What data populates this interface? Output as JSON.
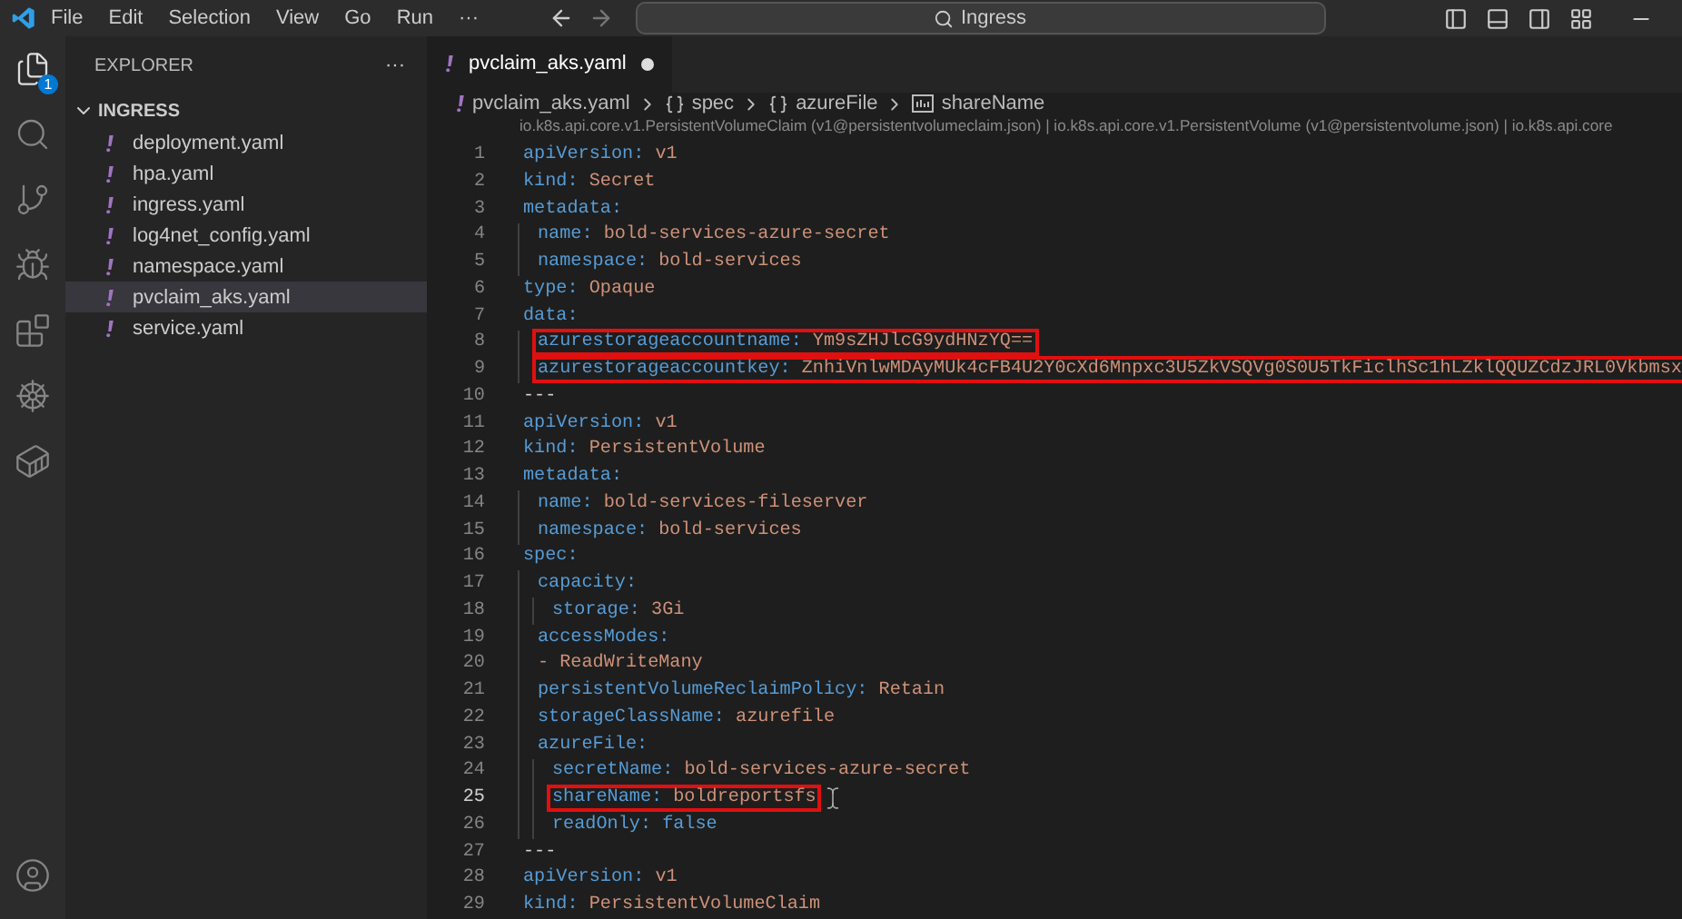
{
  "menu_bar": {
    "items": [
      "File",
      "Edit",
      "Selection",
      "View",
      "Go",
      "Run",
      "···"
    ],
    "search": {
      "value": "Ingress"
    }
  },
  "activity_bar": {
    "badge": "1"
  },
  "sidebar": {
    "title": "EXPLORER",
    "more": "···",
    "folder": {
      "label": "INGRESS",
      "expanded": true,
      "files": [
        {
          "label": "deployment.yaml",
          "selected": false
        },
        {
          "label": "hpa.yaml",
          "selected": false
        },
        {
          "label": "ingress.yaml",
          "selected": false
        },
        {
          "label": "log4net_config.yaml",
          "selected": false
        },
        {
          "label": "namespace.yaml",
          "selected": false
        },
        {
          "label": "pvclaim_aks.yaml",
          "selected": true
        },
        {
          "label": "service.yaml",
          "selected": false
        }
      ]
    }
  },
  "tabs": [
    {
      "label": "pvclaim_aks.yaml",
      "selected": true,
      "modified": true
    }
  ],
  "breadcrumb": [
    {
      "kind": "file",
      "label": "pvclaim_aks.yaml"
    },
    {
      "kind": "object",
      "label": "spec"
    },
    {
      "kind": "object",
      "label": "azureFile"
    },
    {
      "kind": "string",
      "label": "shareName"
    }
  ],
  "schema_info": "io.k8s.api.core.v1.PersistentVolumeClaim (v1@persistentvolumeclaim.json) | io.k8s.api.core.v1.PersistentVolume (v1@persistentvolume.json) | io.k8s.api.core",
  "editor": {
    "lines": [
      {
        "number": "1",
        "kind": "pair",
        "key": "apiVersion:",
        "value": "v1",
        "highlighted": false,
        "current": false
      },
      {
        "number": "2",
        "kind": "pair",
        "key": "kind:",
        "value": "Secret",
        "highlighted": false,
        "current": false
      },
      {
        "number": "3",
        "kind": "mapping",
        "key": "metadata:",
        "highlighted": false,
        "current": false,
        "children": [
          {
            "number": "4",
            "kind": "pair",
            "key": "name:",
            "value": "bold-services-azure-secret",
            "highlighted": false,
            "current": false
          },
          {
            "number": "5",
            "kind": "pair",
            "key": "namespace:",
            "value": "bold-services",
            "highlighted": false,
            "current": false
          }
        ]
      },
      {
        "number": "6",
        "kind": "pair",
        "key": "type:",
        "value": "Opaque",
        "highlighted": false,
        "current": false
      },
      {
        "number": "7",
        "kind": "mapping",
        "key": "data:",
        "highlighted": false,
        "current": false,
        "children": [
          {
            "number": "8",
            "kind": "pair",
            "key": "azurestorageaccountname:",
            "value": "Ym9sZHJlcG9ydHNzYQ==",
            "highlighted": true,
            "current": false
          },
          {
            "number": "9",
            "kind": "pair",
            "key": "azurestorageaccountkey:",
            "value": "ZnhiVnlwMDAyMUk4cFB4U2Y0cXd6Mnpxc3U5ZkVSQVg0S0U5TkFiclhSc1hLZklQQUZCdzJRL0Vkbmsx",
            "highlighted": true,
            "current": false
          }
        ]
      },
      {
        "number": "10",
        "kind": "separator",
        "text": "---",
        "highlighted": false,
        "current": false
      },
      {
        "number": "11",
        "kind": "pair",
        "key": "apiVersion:",
        "value": "v1",
        "highlighted": false,
        "current": false
      },
      {
        "number": "12",
        "kind": "pair",
        "key": "kind:",
        "value": "PersistentVolume",
        "highlighted": false,
        "current": false
      },
      {
        "number": "13",
        "kind": "mapping",
        "key": "metadata:",
        "highlighted": false,
        "current": false,
        "children": [
          {
            "number": "14",
            "kind": "pair",
            "key": "name:",
            "value": "bold-services-fileserver",
            "highlighted": false,
            "current": false
          },
          {
            "number": "15",
            "kind": "pair",
            "key": "namespace:",
            "value": "bold-services",
            "highlighted": false,
            "current": false
          }
        ]
      },
      {
        "number": "16",
        "kind": "mapping",
        "key": "spec:",
        "highlighted": false,
        "current": false,
        "children": [
          {
            "number": "17",
            "kind": "mapping",
            "key": "capacity:",
            "highlighted": false,
            "current": false,
            "children": [
              {
                "number": "18",
                "kind": "pair",
                "key": "storage:",
                "value": "3Gi",
                "highlighted": false,
                "current": false
              }
            ]
          },
          {
            "number": "19",
            "kind": "mapping",
            "key": "accessModes:",
            "highlighted": false,
            "current": false
          },
          {
            "number": "20",
            "kind": "item",
            "text": "- ReadWriteMany",
            "highlighted": false,
            "current": false
          },
          {
            "number": "21",
            "kind": "pair",
            "key": "persistentVolumeReclaimPolicy:",
            "value": "Retain",
            "highlighted": false,
            "current": false
          },
          {
            "number": "22",
            "kind": "pair",
            "key": "storageClassName:",
            "value": "azurefile",
            "highlighted": false,
            "current": false
          },
          {
            "number": "23",
            "kind": "mapping",
            "key": "azureFile:",
            "highlighted": false,
            "current": false,
            "children": [
              {
                "number": "24",
                "kind": "pair",
                "key": "secretName:",
                "value": "bold-services-azure-secret",
                "highlighted": false,
                "current": false
              },
              {
                "number": "25",
                "kind": "pair",
                "key": "shareName:",
                "value": "boldreportsfs",
                "highlighted": true,
                "current": true
              },
              {
                "number": "26",
                "kind": "flag",
                "key": "readOnly:",
                "value": "false",
                "highlighted": false,
                "current": false
              }
            ]
          }
        ]
      },
      {
        "number": "27",
        "kind": "separator",
        "text": "---",
        "highlighted": false,
        "current": false
      },
      {
        "number": "28",
        "kind": "pair",
        "key": "apiVersion:",
        "value": "v1",
        "highlighted": false,
        "current": false
      },
      {
        "number": "29",
        "kind": "pair",
        "key": "kind:",
        "value": "PersistentVolumeClaim",
        "highlighted": false,
        "current": false
      }
    ]
  }
}
